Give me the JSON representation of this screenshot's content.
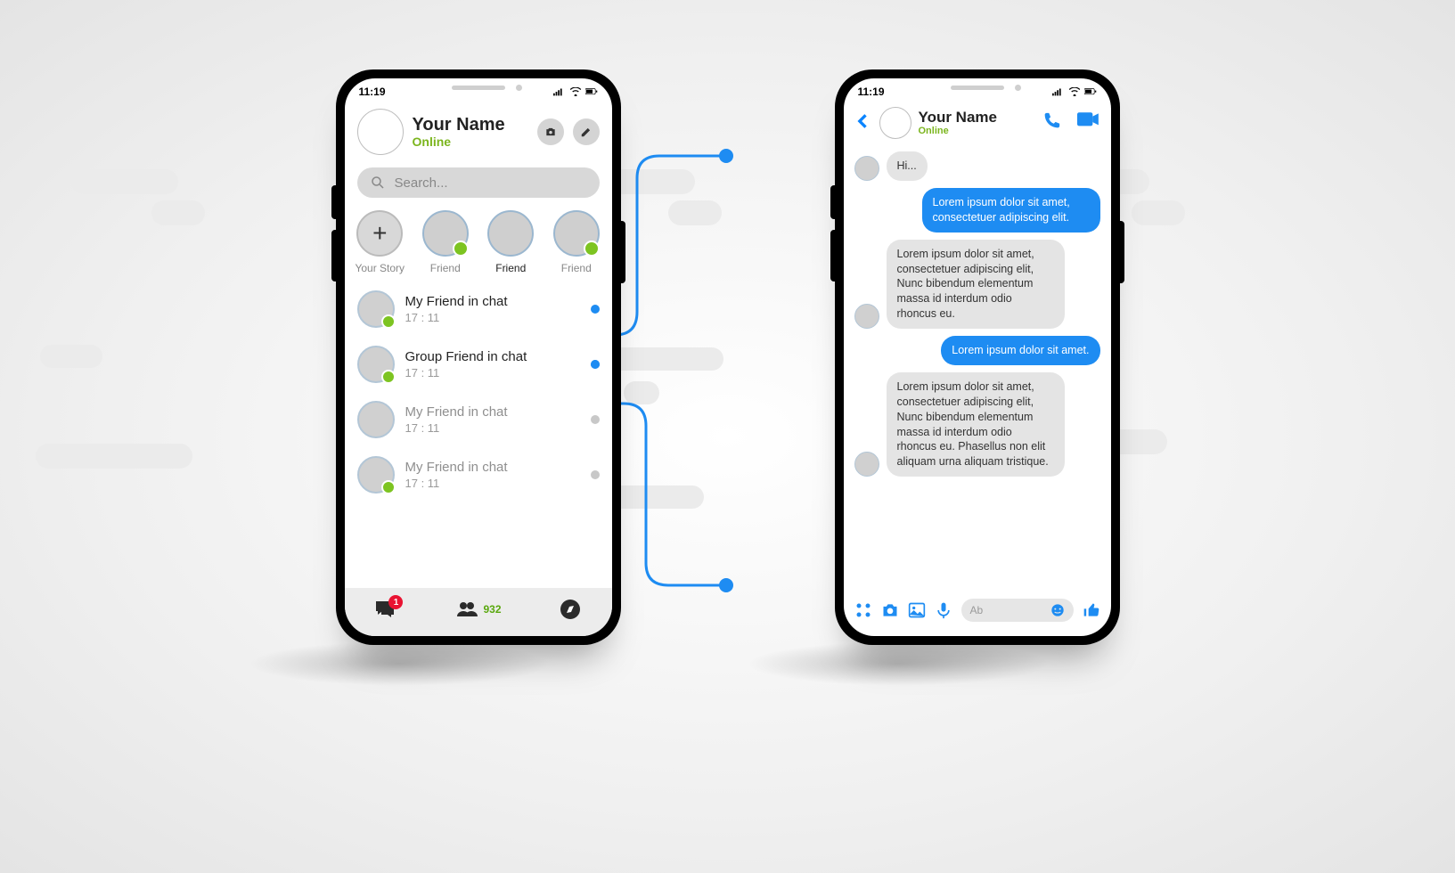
{
  "status_time": "11:19",
  "profile": {
    "name": "Your Name",
    "status": "Online"
  },
  "search": {
    "placeholder": "Search..."
  },
  "stories": [
    {
      "label": "Your Story",
      "add": true,
      "plus": "+"
    },
    {
      "label": "Friend",
      "presence": true
    },
    {
      "label": "Friend",
      "presence": false,
      "active": true
    },
    {
      "label": "Friend",
      "presence": true
    }
  ],
  "chats": [
    {
      "name": "My Friend in chat",
      "time": "17 : 11",
      "presence": true,
      "indicator": "blue"
    },
    {
      "name": "Group Friend in chat",
      "time": "17 : 11",
      "presence": true,
      "group": true,
      "indicator": "blue-double"
    },
    {
      "name": "My Friend in chat",
      "time": "17 : 11",
      "presence": false,
      "indicator": "gray",
      "read": true
    },
    {
      "name": "My Friend in chat",
      "time": "17 : 11",
      "presence": true,
      "indicator": "gray",
      "read": true
    }
  ],
  "bottom": {
    "badge": "1",
    "friends_count": "932"
  },
  "chat_header": {
    "name": "Your Name",
    "status": "Online"
  },
  "messages": [
    {
      "side": "left",
      "text": "Hi...",
      "avatar": true
    },
    {
      "side": "right",
      "text": "Lorem ipsum dolor sit amet, consectetuer adipiscing elit."
    },
    {
      "side": "left",
      "text": "Lorem ipsum dolor sit amet, consectetuer adipiscing elit, Nunc bibendum elementum massa id interdum odio rhoncus eu.",
      "avatar": true
    },
    {
      "side": "right",
      "text": "Lorem ipsum dolor sit amet."
    },
    {
      "side": "left",
      "text": "Lorem ipsum dolor sit amet, consectetuer adipiscing elit, Nunc bibendum elementum massa id interdum odio rhoncus eu. Phasellus non elit aliquam urna aliquam tristique.",
      "avatar": true
    }
  ],
  "input": {
    "placeholder": "Ab"
  }
}
